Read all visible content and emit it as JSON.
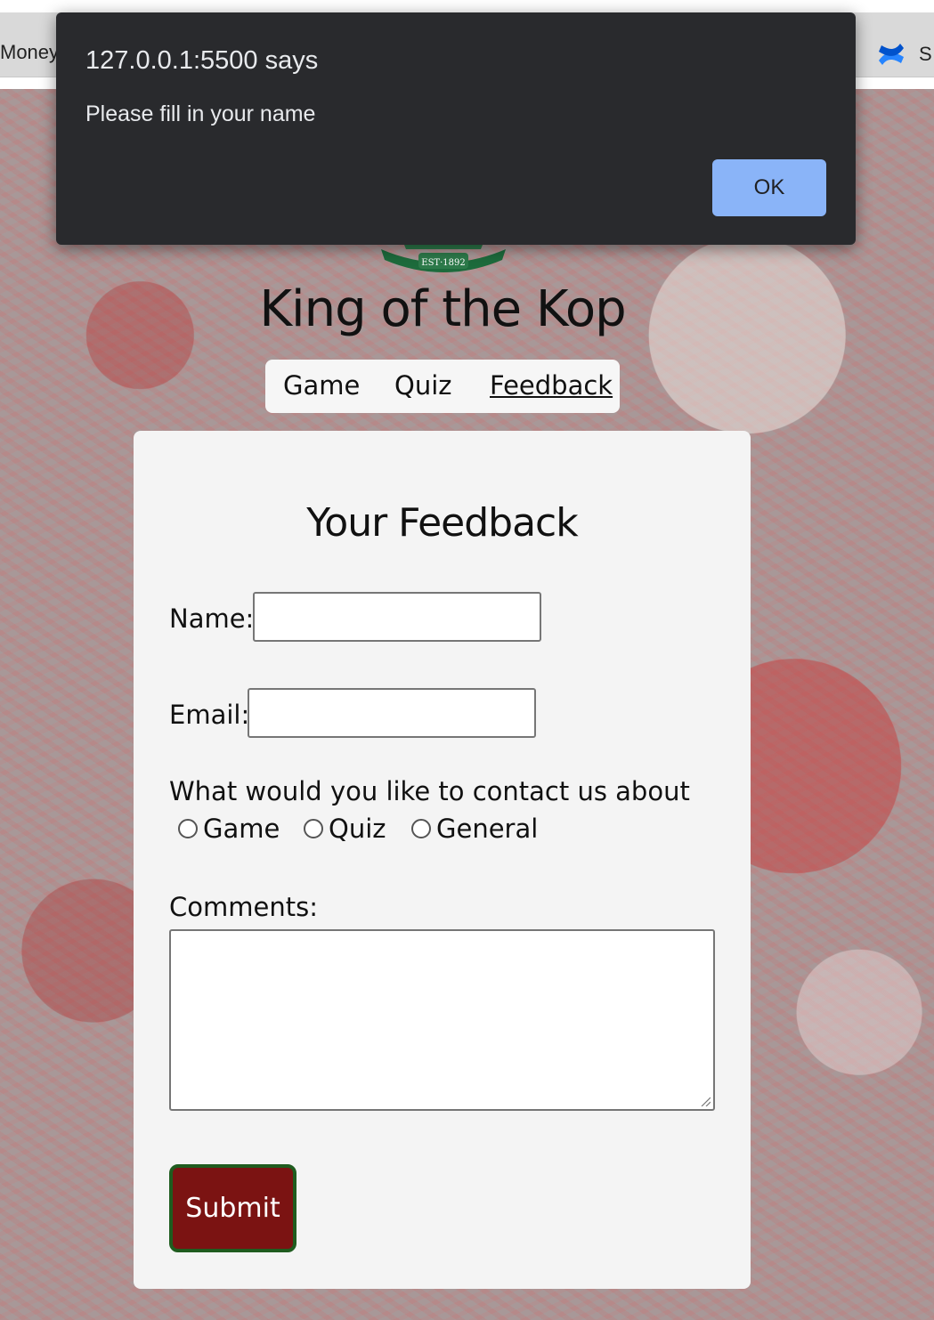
{
  "browser": {
    "bookmark_left": "Money",
    "bookmark_right_label": "S",
    "bookmark_right_icon": "confluence-icon"
  },
  "site": {
    "crest_text": "EST·1892",
    "title": "King of the Kop",
    "nav": [
      {
        "label": "Game",
        "active": false
      },
      {
        "label": "Quiz",
        "active": false
      },
      {
        "label": "Feedback",
        "active": true
      }
    ]
  },
  "form": {
    "heading": "Your Feedback",
    "name_label": "Name:",
    "name_value": "",
    "email_label": "Email:",
    "email_value": "",
    "topic_question": "What would you like to contact us about",
    "topics": [
      {
        "label": "Game",
        "checked": false
      },
      {
        "label": "Quiz",
        "checked": false
      },
      {
        "label": "General",
        "checked": false
      }
    ],
    "comments_label": "Comments:",
    "comments_value": "",
    "submit_label": "Submit"
  },
  "dialog": {
    "origin": "127.0.0.1:5500 says",
    "message": "Please fill in your name",
    "ok_label": "OK"
  },
  "colors": {
    "submit_bg": "#7b1312",
    "submit_border": "#1f5c1f",
    "dialog_bg": "#292a2d",
    "ok_bg": "#8ab4f8"
  }
}
